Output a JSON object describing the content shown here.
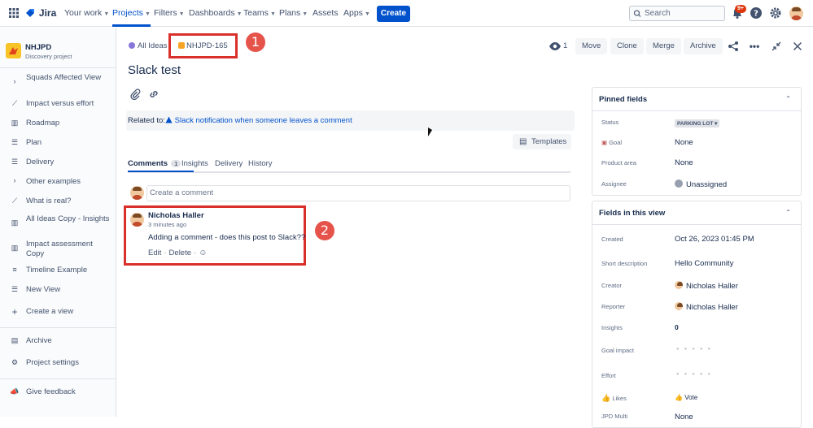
{
  "topbar": {
    "product": "Jira",
    "nav": [
      {
        "label": "Your work"
      },
      {
        "label": "Projects"
      },
      {
        "label": "Filters"
      },
      {
        "label": "Dashboards"
      },
      {
        "label": "Teams"
      },
      {
        "label": "Plans"
      },
      {
        "label": "Assets"
      },
      {
        "label": "Apps"
      }
    ],
    "create_label": "Create",
    "search_placeholder": "Search",
    "notifications_badge": "9+"
  },
  "sidebar": {
    "project_name": "NHJPD",
    "project_type": "Discovery project",
    "items": [
      {
        "icon": "chevron-right-icon",
        "label": "Squads Affected View"
      },
      {
        "icon": "chart-icon",
        "label": "Impact versus effort"
      },
      {
        "icon": "board-icon",
        "label": "Roadmap"
      },
      {
        "icon": "list-icon",
        "label": "Plan"
      },
      {
        "icon": "list-icon",
        "label": "Delivery"
      },
      {
        "icon": "chevron-right-icon",
        "label": "Other examples"
      },
      {
        "icon": "chart-icon",
        "label": "What is real?"
      },
      {
        "icon": "board-icon",
        "label": "All Ideas Copy - Insights"
      },
      {
        "icon": "board-icon",
        "label": "Impact assessment Copy"
      },
      {
        "icon": "timeline-icon",
        "label": "Timeline Example"
      },
      {
        "icon": "list-icon",
        "label": "New View"
      },
      {
        "icon": "plus-icon",
        "label": "Create a view"
      }
    ],
    "archive_label": "Archive",
    "settings_label": "Project settings",
    "feedback_label": "Give feedback"
  },
  "issue": {
    "breadcrumb_parent": "All Ideas",
    "key": "NHJPD-165",
    "title": "Slack test",
    "watchers": "1",
    "actions": [
      "Move",
      "Clone",
      "Merge",
      "Archive"
    ],
    "related_label": "Related to:",
    "related_value": "Slack notification when someone leaves a comment",
    "templates_label": "Templates"
  },
  "tabs": [
    {
      "label": "Comments",
      "count": "1"
    },
    {
      "label": "Insights"
    },
    {
      "label": "Delivery"
    },
    {
      "label": "History"
    }
  ],
  "comment_placeholder": "Create a comment",
  "comment": {
    "author": "Nicholas Haller",
    "time": "3 minutes ago",
    "body": "Adding a comment - does this post to Slack??",
    "edit": "Edit",
    "delete": "Delete"
  },
  "callouts": [
    "1",
    "2"
  ],
  "pinned": {
    "title": "Pinned fields",
    "fields": [
      {
        "label": "Status",
        "value": "PARKING LOT"
      },
      {
        "label": "Goal",
        "value": "None"
      },
      {
        "label": "Product area",
        "value": "None"
      },
      {
        "label": "Assignee",
        "value": "Unassigned"
      }
    ]
  },
  "view_fields": {
    "title": "Fields in this view",
    "fields": [
      {
        "label": "Created",
        "value": "Oct 26, 2023 01:45 PM"
      },
      {
        "label": "Short description",
        "value": "Hello Community"
      },
      {
        "label": "Creator",
        "value": "Nicholas Haller"
      },
      {
        "label": "Reporter",
        "value": "Nicholas Haller"
      },
      {
        "label": "Insights",
        "value": "0"
      },
      {
        "label": "Goal impact",
        "value": ""
      },
      {
        "label": "Effort",
        "value": ""
      },
      {
        "label": "Likes",
        "value": "Vote"
      },
      {
        "label": "JPD Multi",
        "value": "None"
      }
    ]
  },
  "colors": {
    "brand": "#0052cc",
    "callout": "#e5534b",
    "annotation_box": "#d9302c"
  }
}
